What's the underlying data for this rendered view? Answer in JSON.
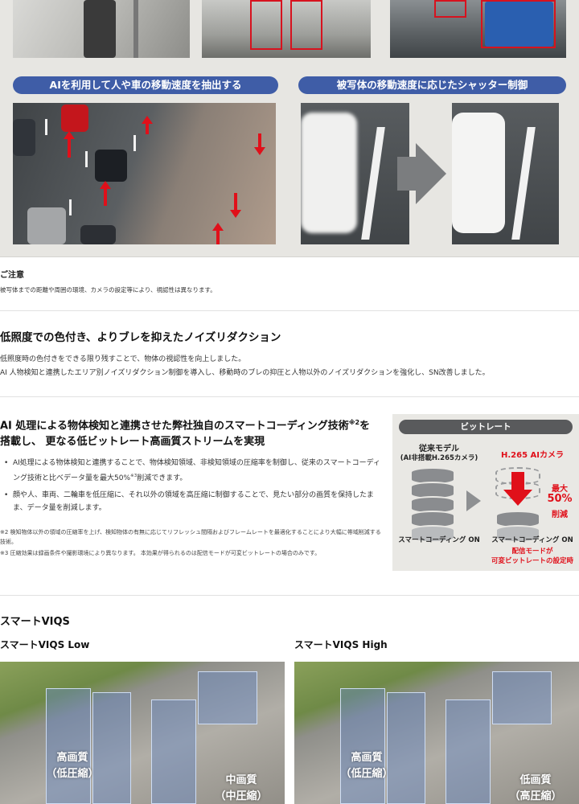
{
  "top_panel": {
    "section1_label": "AIを利用して人や車の移動速度を抽出する",
    "section2_label": "被写体の移動速度に応じたシャッター制御"
  },
  "note": {
    "title": "ご注意",
    "text": "被写体までの距離や周囲の環境、カメラの設定等により、視認性は異なります。"
  },
  "noise": {
    "heading": "低照度での色付き、よりブレを抑えたノイズリダクション",
    "line1": "低照度時の色付きをできる限り残すことで、物体の視認性を向上しました。",
    "line2": "AI 人物検知と連携したエリア別ノイズリダクション制御を導入し、移動時のブレの抑圧と人物以外のノイズリダクションを強化し、SN改善しました。"
  },
  "smart_coding": {
    "heading_part1": "AI 処理による物体検知と連携させた弊社独自のスマートコーディング技術",
    "heading_sup": "※2",
    "heading_part2": "を",
    "heading_line2": "搭載し、 更なる低ビットレート高画質ストリームを実現",
    "bullet1": "AI処理による物体検知と連携することで、物体検知領域、非検知領域の圧縮率を制御し、従来のスマートコーディング技術と比べデータ量を最大50%",
    "bullet1_sup": "※3",
    "bullet1_end": "削減できます。",
    "bullet2": "顔や人、車両、二輪車を低圧縮に、それ以外の領域を高圧縮に制御することで、見たい部分の画質を保持したまま、データ量を削減します。",
    "footnote2": "※2 検知物体以外の領域の圧縮率を上げ、検知物体の有無に応じてリフレッシュ間隔およびフレームレートを最適化することにより大幅に帯域削減する技術。",
    "footnote3": "※3 圧縮効果は録画条件や撮影環境により異なります。 本効果が得られるのは配信モードが可変ビットレートの場合のみです。"
  },
  "bitrate": {
    "title": "ビットレート",
    "legacy_label": "従来モデル",
    "legacy_sub": "(AI非搭載H.265カメラ)",
    "ai_label": "H.265 AIカメラ",
    "reduction_prefix": "最大",
    "reduction_value": "50%",
    "reduction_suffix": "削減",
    "left_caption": "スマートコーディング ON",
    "right_caption": "スマートコーディング ON",
    "note_line1": "配信モードが",
    "note_line2": "可変ビットレートの設定時",
    "accent_color": "#e0101a"
  },
  "viqs": {
    "heading": "スマートVIQS",
    "low_title": "スマートVIQS Low",
    "high_title": "スマートVIQS High",
    "low_label1": "高画質",
    "low_label2": "（低圧縮）",
    "low_label3": "中画質",
    "low_label4": "（中圧縮）",
    "high_label1": "高画質",
    "high_label2": "（低圧縮）",
    "high_label3": "低画質",
    "high_label4": "（高圧縮）"
  }
}
